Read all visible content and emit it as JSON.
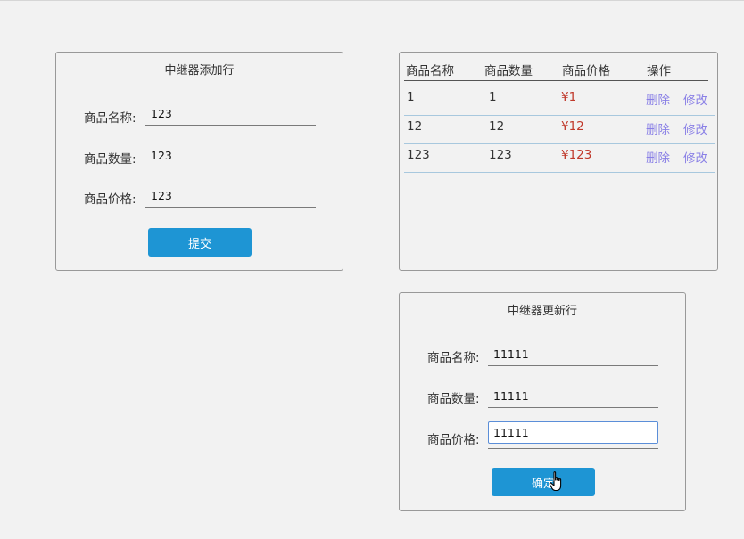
{
  "add_form": {
    "title": "中继器添加行",
    "name_label": "商品名称:",
    "name_value": "123",
    "qty_label": "商品数量:",
    "qty_value": "123",
    "price_label": "商品价格:",
    "price_value": "123",
    "submit_label": "提交"
  },
  "table": {
    "headers": [
      "商品名称",
      "商品数量",
      "商品价格",
      "操作"
    ],
    "rows": [
      {
        "name": "1",
        "qty": "1",
        "price": "¥1",
        "delete": "删除",
        "edit": "修改"
      },
      {
        "name": "12",
        "qty": "12",
        "price": "¥12",
        "delete": "删除",
        "edit": "修改"
      },
      {
        "name": "123",
        "qty": "123",
        "price": "¥123",
        "delete": "删除",
        "edit": "修改"
      }
    ]
  },
  "update_form": {
    "title": "中继器更新行",
    "name_label": "商品名称:",
    "name_value": "11111",
    "qty_label": "商品数量:",
    "qty_value": "11111",
    "price_label": "商品价格:",
    "price_value": "11111",
    "confirm_label": "确定"
  },
  "colors": {
    "button": "#1e95d4",
    "price": "#c0392b",
    "link": "#8a80e6"
  },
  "icons": {
    "cursor": "hand-pointer-icon"
  }
}
